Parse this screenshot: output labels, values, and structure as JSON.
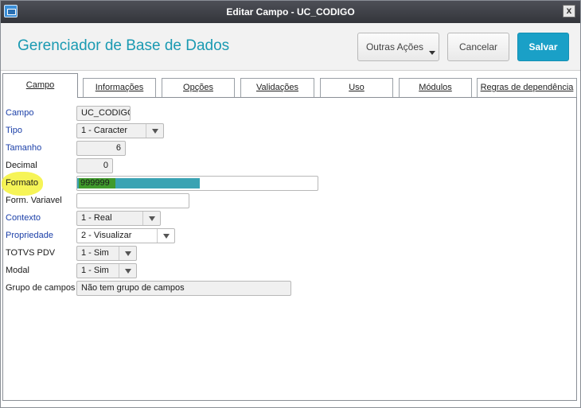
{
  "window": {
    "title": "Editar Campo - UC_CODIGO",
    "close_label": "x"
  },
  "header": {
    "heading": "Gerenciador de Base de Dados",
    "outras_acoes": "Outras Ações",
    "cancelar": "Cancelar",
    "salvar": "Salvar"
  },
  "tabs": [
    {
      "label": "Campo"
    },
    {
      "label": "Informações"
    },
    {
      "label": "Opções"
    },
    {
      "label": "Validações"
    },
    {
      "label": "Uso"
    },
    {
      "label": "Módulos"
    },
    {
      "label": "Regras de dependência"
    }
  ],
  "fields": {
    "campo": {
      "label": "Campo",
      "value": "UC_CODIGO"
    },
    "tipo": {
      "label": "Tipo",
      "value": "1 - Caracter"
    },
    "tamanho": {
      "label": "Tamanho",
      "value": "6"
    },
    "decimal": {
      "label": "Decimal",
      "value": "0"
    },
    "formato": {
      "label": "Formato",
      "value": "999999"
    },
    "form_variavel": {
      "label": "Form. Variavel",
      "value": ""
    },
    "contexto": {
      "label": "Contexto",
      "value": "1 - Real"
    },
    "propriedade": {
      "label": "Propriedade",
      "value": "2 - Visualizar"
    },
    "totvs_pdv": {
      "label": "TOTVS PDV",
      "value": "1 - Sim"
    },
    "modal": {
      "label": "Modal",
      "value": "1 - Sim"
    },
    "grupo_campos": {
      "label": "Grupo de campos",
      "value": "Não tem grupo de campos"
    }
  },
  "colors": {
    "title_accent": "#1a9ab2",
    "primary_button": "#1aa0c7",
    "required_label": "#1b3fa8",
    "highlight": "#f4f23a"
  }
}
